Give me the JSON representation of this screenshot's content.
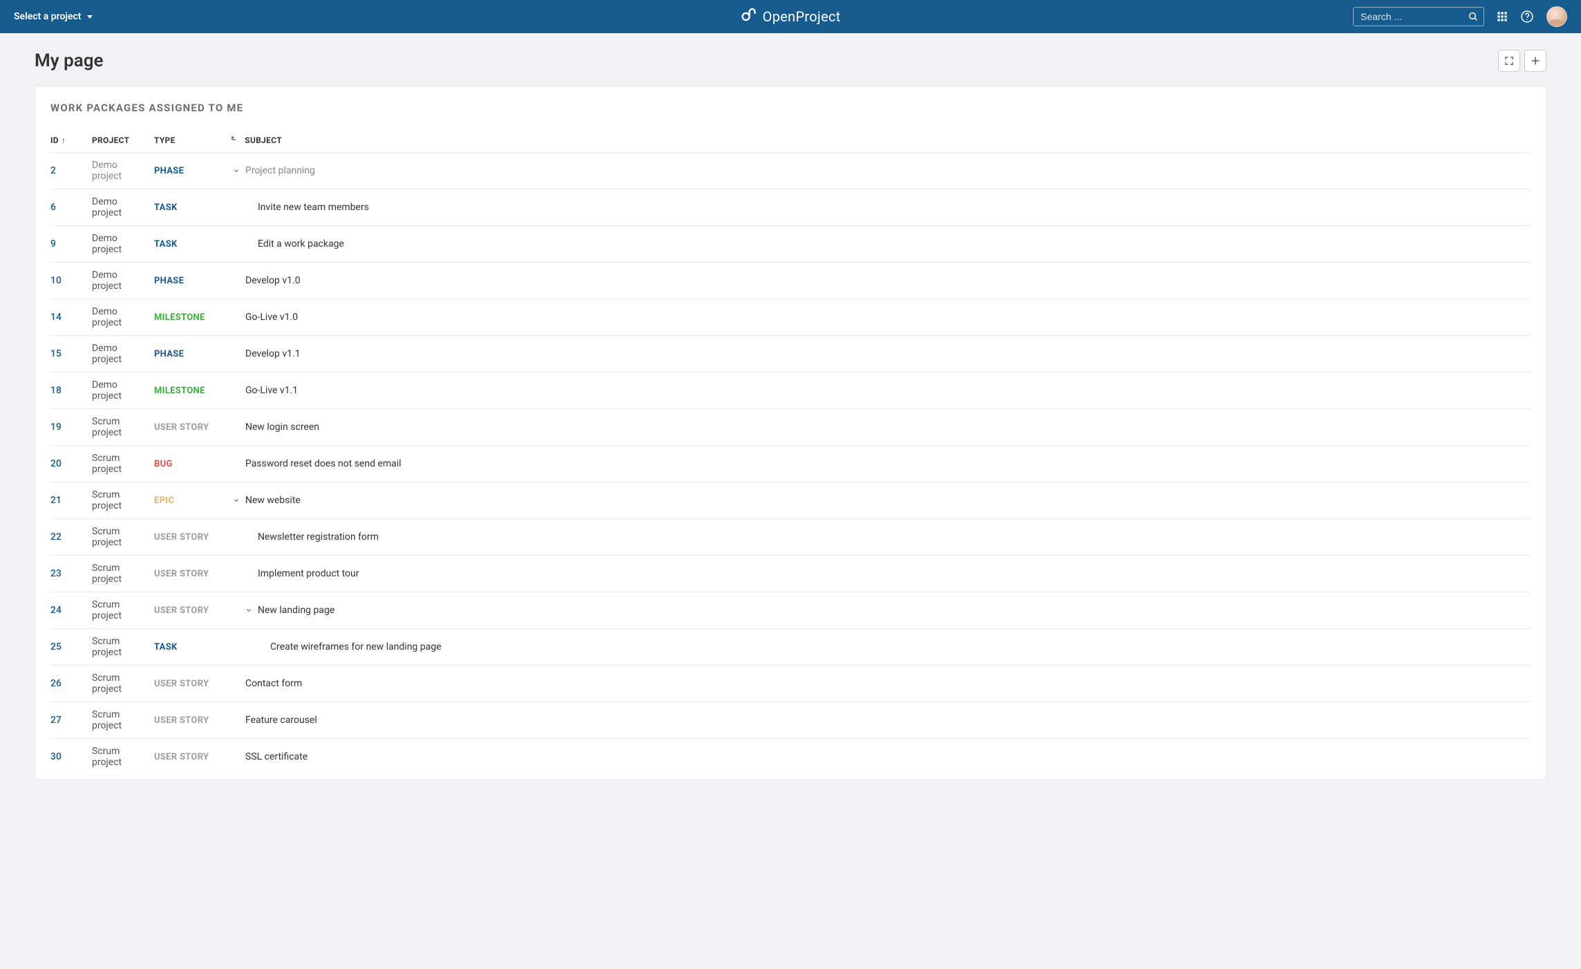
{
  "topbar": {
    "project_selector": "Select a project",
    "brand": "OpenProject",
    "search_placeholder": "Search ..."
  },
  "page": {
    "title": "My page"
  },
  "widget": {
    "title": "WORK PACKAGES ASSIGNED TO ME",
    "columns": {
      "id": "ID",
      "project": "PROJECT",
      "type": "TYPE",
      "subject": "SUBJECT"
    }
  },
  "type_styles": {
    "PHASE": "type-PHASE",
    "TASK": "type-TASK",
    "MILESTONE": "type-MILESTONE",
    "USER STORY": "type-USERSTORY",
    "BUG": "type-BUG",
    "EPIC": "type-EPIC"
  },
  "rows": [
    {
      "id": "2",
      "project": "Demo project",
      "project_muted": true,
      "type": "PHASE",
      "subject": "Project planning",
      "subject_muted": true,
      "indent": 0,
      "toggle": true
    },
    {
      "id": "6",
      "project": "Demo project",
      "type": "TASK",
      "subject": "Invite new team members",
      "indent": 1
    },
    {
      "id": "9",
      "project": "Demo project",
      "type": "TASK",
      "subject": "Edit a work package",
      "indent": 1
    },
    {
      "id": "10",
      "project": "Demo project",
      "type": "PHASE",
      "subject": "Develop v1.0",
      "indent": 0
    },
    {
      "id": "14",
      "project": "Demo project",
      "type": "MILESTONE",
      "subject": "Go-Live v1.0",
      "indent": 0
    },
    {
      "id": "15",
      "project": "Demo project",
      "type": "PHASE",
      "subject": "Develop v1.1",
      "indent": 0
    },
    {
      "id": "18",
      "project": "Demo project",
      "type": "MILESTONE",
      "subject": "Go-Live v1.1",
      "indent": 0
    },
    {
      "id": "19",
      "project": "Scrum project",
      "type": "USER STORY",
      "subject": "New login screen",
      "indent": 0
    },
    {
      "id": "20",
      "project": "Scrum project",
      "type": "BUG",
      "subject": "Password reset does not send email",
      "indent": 0
    },
    {
      "id": "21",
      "project": "Scrum project",
      "type": "EPIC",
      "subject": "New website",
      "indent": 0,
      "toggle": true
    },
    {
      "id": "22",
      "project": "Scrum project",
      "type": "USER STORY",
      "subject": "Newsletter registration form",
      "indent": 1
    },
    {
      "id": "23",
      "project": "Scrum project",
      "type": "USER STORY",
      "subject": "Implement product tour",
      "indent": 1
    },
    {
      "id": "24",
      "project": "Scrum project",
      "type": "USER STORY",
      "subject": "New landing page",
      "indent": 1,
      "toggle": true
    },
    {
      "id": "25",
      "project": "Scrum project",
      "type": "TASK",
      "subject": "Create wireframes for new landing page",
      "indent": 2
    },
    {
      "id": "26",
      "project": "Scrum project",
      "type": "USER STORY",
      "subject": "Contact form",
      "indent": 0
    },
    {
      "id": "27",
      "project": "Scrum project",
      "type": "USER STORY",
      "subject": "Feature carousel",
      "indent": 0
    },
    {
      "id": "30",
      "project": "Scrum project",
      "type": "USER STORY",
      "subject": "SSL certificate",
      "indent": 0
    }
  ]
}
